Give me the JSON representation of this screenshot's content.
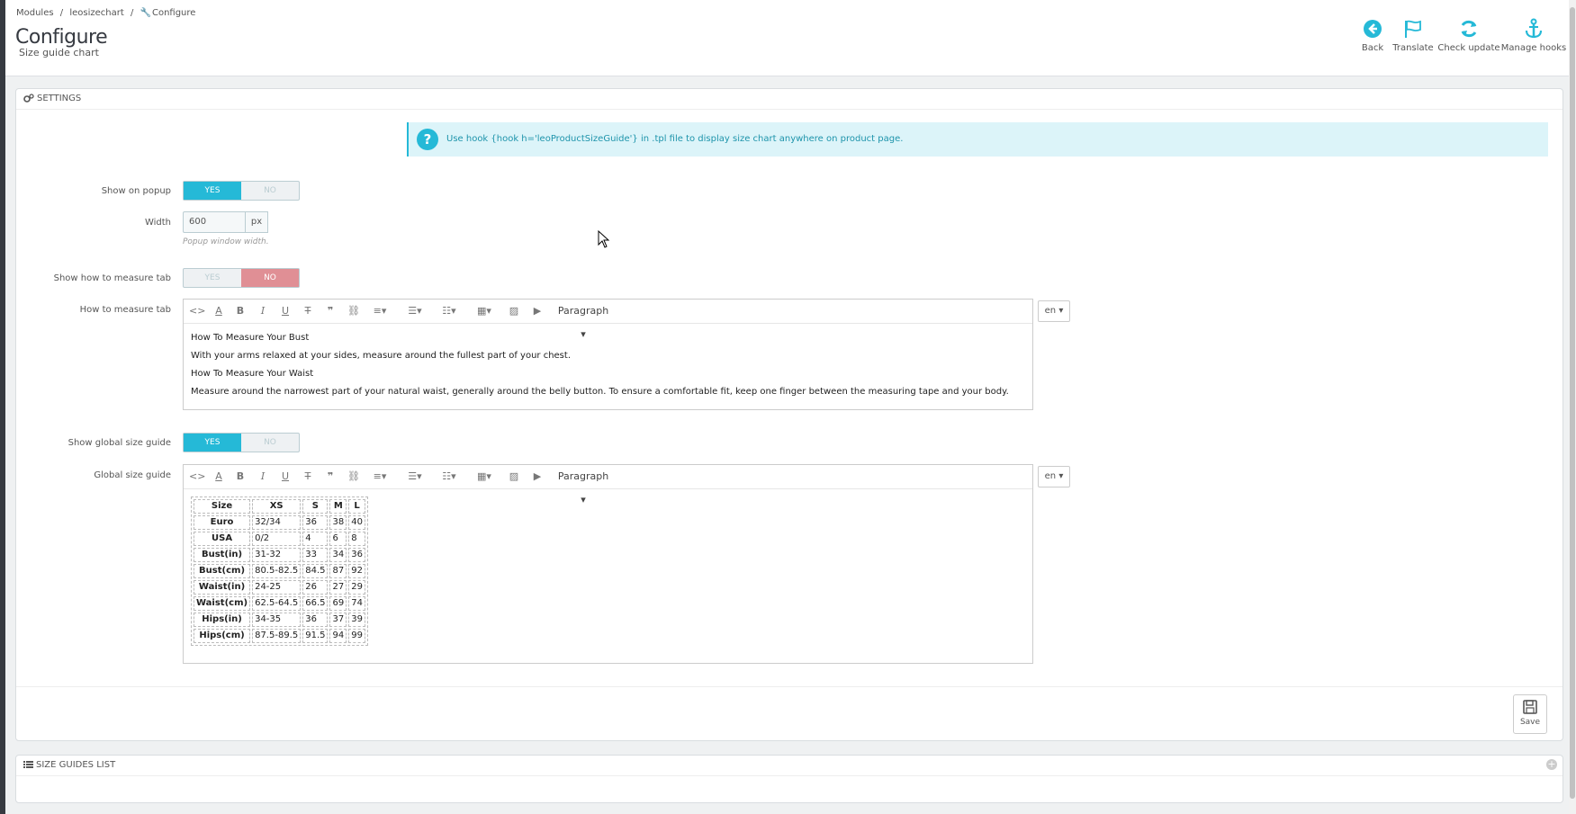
{
  "breadcrumb": {
    "modules": "Modules",
    "module": "leosizechart",
    "current": "Configure",
    "sep": "/"
  },
  "page": {
    "title": "Configure",
    "subtitle": "Size guide chart"
  },
  "toolbar_buttons": {
    "back": "Back",
    "translate": "Translate",
    "check_update": "Check update",
    "manage_hooks": "Manage hooks"
  },
  "settings": {
    "heading": "SETTINGS",
    "alert": "Use hook {hook h='leoProductSizeGuide'} in .tpl file to display size chart anywhere on product page.",
    "show_on_popup": {
      "label": "Show on popup",
      "yes": "YES",
      "no": "NO",
      "value": "YES"
    },
    "width": {
      "label": "Width",
      "value": "600",
      "unit": "px",
      "help": "Popup window width."
    },
    "show_measure_tab": {
      "label": "Show how to measure tab",
      "yes": "YES",
      "no": "NO",
      "value": "NO"
    },
    "measure_tab": {
      "label": "How to measure tab",
      "lang": "en",
      "format": "Paragraph",
      "lines": [
        "How To Measure Your Bust",
        "With your arms relaxed at your sides, measure around the fullest part of your chest.",
        "How To Measure Your Waist",
        "Measure around the narrowest part of your natural waist, generally around the belly button. To ensure a comfortable fit, keep one finger between the measuring tape and your body."
      ]
    },
    "show_global": {
      "label": "Show global size guide",
      "yes": "YES",
      "no": "NO",
      "value": "YES"
    },
    "global_guide": {
      "label": "Global size guide",
      "lang": "en",
      "format": "Paragraph",
      "table": {
        "header": [
          "Size",
          "XS",
          "S",
          "M",
          "L"
        ],
        "rows": [
          [
            "Euro",
            "32/34",
            "36",
            "38",
            "40"
          ],
          [
            "USA",
            "0/2",
            "4",
            "6",
            "8"
          ],
          [
            "Bust(in)",
            "31-32",
            "33",
            "34",
            "36"
          ],
          [
            "Bust(cm)",
            "80.5-82.5",
            "84.5",
            "87",
            "92"
          ],
          [
            "Waist(in)",
            "24-25",
            "26",
            "27",
            "29"
          ],
          [
            "Waist(cm)",
            "62.5-64.5",
            "66.5",
            "69",
            "74"
          ],
          [
            "Hips(in)",
            "34-35",
            "36",
            "37",
            "39"
          ],
          [
            "Hips(cm)",
            "87.5-89.5",
            "91.5",
            "94",
            "99"
          ]
        ]
      }
    },
    "save": "Save"
  },
  "size_guides_list": {
    "heading": "SIZE GUIDES LIST"
  },
  "colors": {
    "accent": "#25b9d7",
    "danger": "#e08f95",
    "alert_bg": "#dcf4f9"
  }
}
